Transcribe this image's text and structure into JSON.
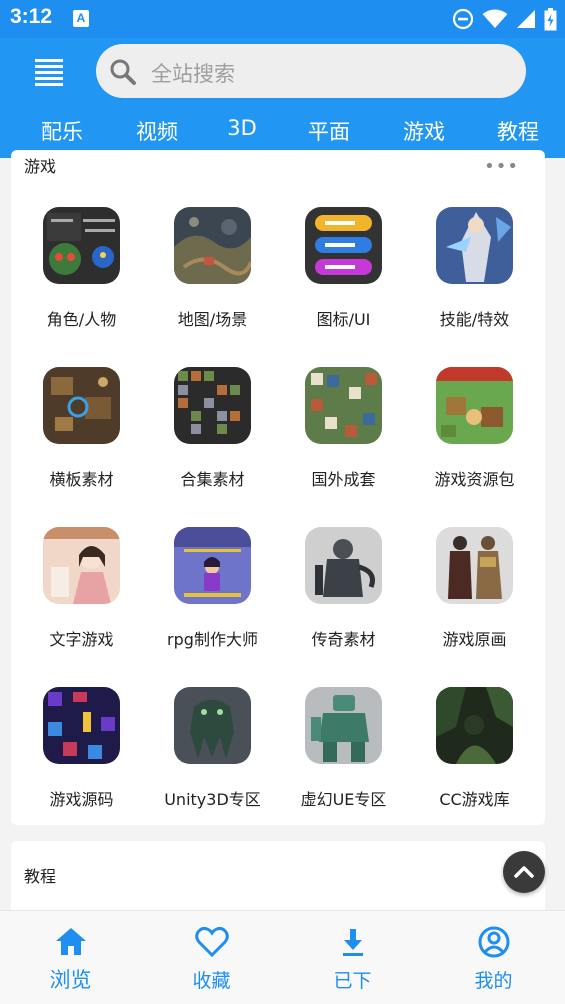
{
  "status_bar": {
    "time": "3:12",
    "notification_icon": "A"
  },
  "header": {
    "search": {
      "placeholder": "全站搜索"
    },
    "tabs": [
      {
        "label": "配乐"
      },
      {
        "label": "视频"
      },
      {
        "label": "3D"
      },
      {
        "label": "平面"
      },
      {
        "label": "游戏"
      },
      {
        "label": "教程"
      }
    ]
  },
  "games_section": {
    "title": "游戏",
    "more": "•••",
    "items": [
      {
        "label": "角色/人物",
        "icon": "character-thumb"
      },
      {
        "label": "地图/场景",
        "icon": "map-thumb"
      },
      {
        "label": "图标/UI",
        "icon": "ui-icon-thumb"
      },
      {
        "label": "技能/特效",
        "icon": "skill-effect-thumb"
      },
      {
        "label": "横板素材",
        "icon": "side-scroller-thumb"
      },
      {
        "label": "合集素材",
        "icon": "collection-thumb"
      },
      {
        "label": "国外成套",
        "icon": "foreign-set-thumb"
      },
      {
        "label": "游戏资源包",
        "icon": "resource-pack-thumb"
      },
      {
        "label": "文字游戏",
        "icon": "text-game-thumb"
      },
      {
        "label": "rpg制作大师",
        "icon": "rpg-maker-thumb"
      },
      {
        "label": "传奇素材",
        "icon": "legend-material-thumb"
      },
      {
        "label": "游戏原画",
        "icon": "concept-art-thumb"
      },
      {
        "label": "游戏源码",
        "icon": "source-code-thumb"
      },
      {
        "label": "Unity3D专区",
        "icon": "unity3d-thumb"
      },
      {
        "label": "虚幻UE专区",
        "icon": "unreal-thumb"
      },
      {
        "label": "CC游戏库",
        "icon": "cc-library-thumb"
      }
    ]
  },
  "tutorial_section": {
    "title": "教程"
  },
  "bottom_nav": [
    {
      "label": "浏览",
      "icon": "home-icon",
      "active": true
    },
    {
      "label": "收藏",
      "icon": "heart-icon",
      "active": false
    },
    {
      "label": "已下",
      "icon": "download-icon",
      "active": false
    },
    {
      "label": "我的",
      "icon": "account-icon",
      "active": false
    }
  ],
  "colors": {
    "primary": "#2196f3",
    "status_bar": "#1e8ef0",
    "accent": "#1e8ef0"
  }
}
